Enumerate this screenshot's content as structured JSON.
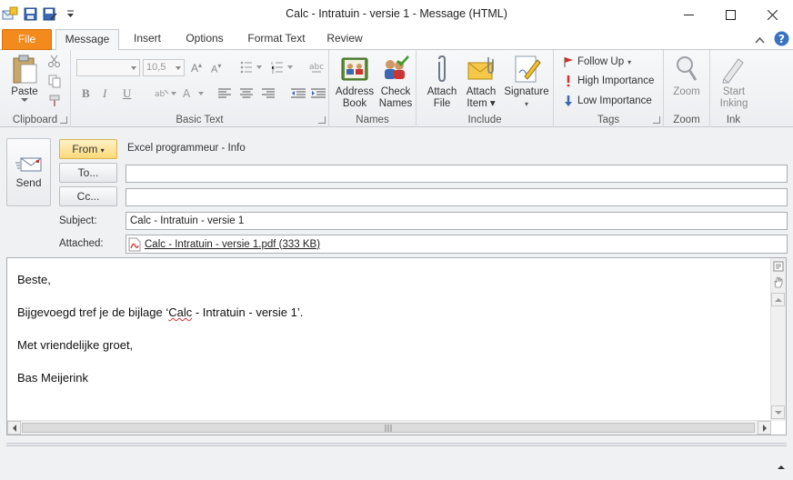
{
  "window": {
    "title": "Calc - Intratuin - versie 1  -  Message (HTML)"
  },
  "tabs": [
    "File",
    "Message",
    "Insert",
    "Options",
    "Format Text",
    "Review"
  ],
  "ribbon": {
    "clipboard": {
      "label": "Clipboard",
      "paste": "Paste"
    },
    "basic_text": {
      "label": "Basic Text",
      "font_size": "10,5"
    },
    "names": {
      "label": "Names",
      "address_book_1": "Address",
      "address_book_2": "Book",
      "check_names_1": "Check",
      "check_names_2": "Names"
    },
    "include": {
      "label": "Include",
      "attach_file_1": "Attach",
      "attach_file_2": "File",
      "attach_item_1": "Attach",
      "attach_item_2": "Item",
      "signature": "Signature"
    },
    "tags": {
      "label": "Tags",
      "follow_up": "Follow Up",
      "high_importance": "High Importance",
      "low_importance": "Low Importance"
    },
    "zoom": {
      "label": "Zoom",
      "zoom": "Zoom"
    },
    "ink": {
      "label": "Ink",
      "start_1": "Start",
      "start_2": "Inking"
    }
  },
  "compose": {
    "send": "Send",
    "from_button": "From",
    "from_value": "Excel programmeur - Info",
    "to_button": "To...",
    "cc_button": "Cc...",
    "to_value": "",
    "cc_value": "",
    "subject_label": "Subject:",
    "subject_value": "Calc - Intratuin - versie 1",
    "attached_label": "Attached:",
    "attachment": "Calc - Intratuin - versie 1.pdf (333 KB)"
  },
  "body": {
    "greeting": "Beste,",
    "line_pre": "Bijgevoegd tref je de bijlage ‘",
    "line_word": "Calc",
    "line_post": " - Intratuin - versie 1’.",
    "closing": "Met vriendelijke groet,",
    "signature": "Bas Meijerink"
  },
  "colors": {
    "file_tab": "#f38a1e",
    "from_button": "#fbd97a"
  }
}
